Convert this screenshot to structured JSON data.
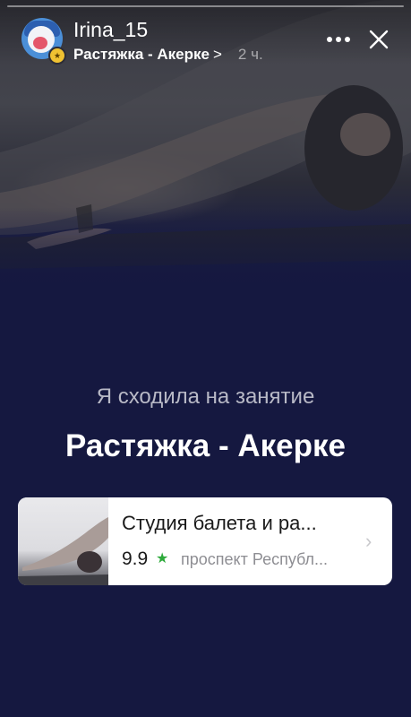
{
  "story": {
    "username": "Irina_15",
    "subtitle": "Растяжка - Акерке",
    "subtitle_chevron": ">",
    "time_ago": "2 ч."
  },
  "content": {
    "caption": "Я сходила на занятие",
    "title": "Растяжка - Акерке"
  },
  "place_card": {
    "name": "Студия балета и ра...",
    "rating": "9.9",
    "rating_star": "★",
    "address": "проспект Республ...",
    "chevron": "›"
  },
  "colors": {
    "background": "#151840",
    "rating_star": "#2eaa3c"
  },
  "icons": [
    "more-icon",
    "close-icon",
    "avatar",
    "badge-icon",
    "chevron-right-icon"
  ]
}
